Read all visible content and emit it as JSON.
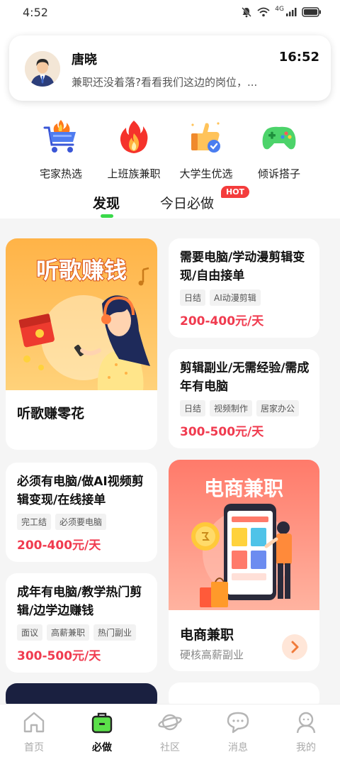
{
  "status_bar": {
    "time": "4:52",
    "net": "4G"
  },
  "notification": {
    "name": "唐晓",
    "time": "16:52",
    "message": "兼职还没着落?看看我们这边的岗位，..."
  },
  "categories": [
    {
      "label": "宅家热选",
      "icon": "cart-icon"
    },
    {
      "label": "上班族兼职",
      "icon": "fire-icon"
    },
    {
      "label": "大学生优选",
      "icon": "thumbs-up-icon"
    },
    {
      "label": "倾诉搭子",
      "icon": "gamepad-icon"
    }
  ],
  "tabs": {
    "discover": "发现",
    "today": "今日必做",
    "hot_badge": "HOT"
  },
  "banner_music": {
    "overlay": "听歌赚钱",
    "title": "听歌赚零花"
  },
  "banner_ecom": {
    "overlay": "电商兼职",
    "title": "电商兼职",
    "subtitle": "硬核高薪副业"
  },
  "jobs": [
    {
      "title": "需要电脑/学动漫剪辑变现/自由接单",
      "tags": [
        "日结",
        "AI动漫剪辑"
      ],
      "salary": "200-400元/天"
    },
    {
      "title": "剪辑副业/无需经验/需成年有电脑",
      "tags": [
        "日结",
        "视频制作",
        "居家办公"
      ],
      "salary": "300-500元/天"
    },
    {
      "title": "必须有电脑/做AI视频剪辑变现/在线接单",
      "tags": [
        "完工结",
        "必须要电脑"
      ],
      "salary": "200-400元/天"
    },
    {
      "title": "成年有电脑/教学热门剪辑/边学边赚钱",
      "tags": [
        "面议",
        "高薪兼职",
        "热门副业"
      ],
      "salary": "300-500元/天"
    }
  ],
  "bottom_nav": [
    {
      "label": "首页",
      "icon": "home-icon"
    },
    {
      "label": "必做",
      "icon": "briefcase-icon"
    },
    {
      "label": "社区",
      "icon": "planet-icon"
    },
    {
      "label": "消息",
      "icon": "chat-icon"
    },
    {
      "label": "我的",
      "icon": "user-icon"
    }
  ],
  "colors": {
    "accent_green": "#3ad94a",
    "salary_red": "#f03b4f",
    "hot_red": "#f43c3c"
  }
}
